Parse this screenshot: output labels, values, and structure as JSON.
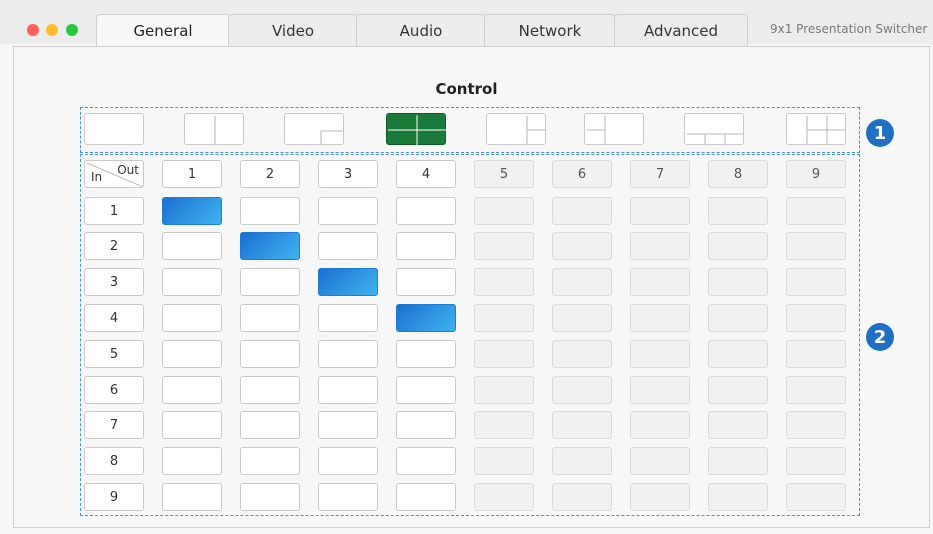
{
  "tabs": [
    {
      "label": "General",
      "active": true
    },
    {
      "label": "Video",
      "active": false
    },
    {
      "label": "Audio",
      "active": false
    },
    {
      "label": "Network",
      "active": false
    },
    {
      "label": "Advanced",
      "active": false
    }
  ],
  "device_title": "9x1 Presentation Switcher",
  "section_title": "Control",
  "layouts": [
    {
      "name": "single",
      "active": false
    },
    {
      "name": "split-2-vertical",
      "active": false
    },
    {
      "name": "pip-bottom-right",
      "active": false
    },
    {
      "name": "quad",
      "active": true
    },
    {
      "name": "split-main-with-right-pair",
      "active": false
    },
    {
      "name": "split-left-pair-with-main",
      "active": false
    },
    {
      "name": "main-with-bottom-triple",
      "active": false
    },
    {
      "name": "main-with-right-grid",
      "active": false
    }
  ],
  "matrix": {
    "corner_in": "In",
    "corner_out": "Out",
    "outputs": [
      "1",
      "2",
      "3",
      "4",
      "5",
      "6",
      "7",
      "8",
      "9"
    ],
    "inputs": [
      "1",
      "2",
      "3",
      "4",
      "5",
      "6",
      "7",
      "8",
      "9"
    ],
    "enabled_outputs": 4,
    "routes": [
      [
        1,
        1
      ],
      [
        2,
        2
      ],
      [
        3,
        3
      ],
      [
        4,
        4
      ]
    ]
  },
  "callouts": [
    "1",
    "2"
  ],
  "colors": {
    "accent": "#1f6fc5",
    "active_layout": "#1a7a3a",
    "selected_cell_start": "#1b6fd0",
    "selected_cell_end": "#3fb4f0"
  }
}
